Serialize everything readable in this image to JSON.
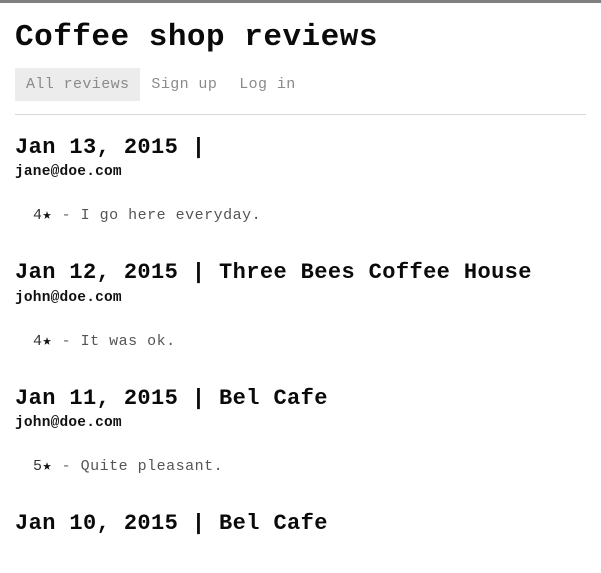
{
  "site": {
    "title": "Coffee shop reviews"
  },
  "nav": {
    "items": [
      {
        "label": "All reviews",
        "active": true
      },
      {
        "label": "Sign up",
        "active": false
      },
      {
        "label": "Log in",
        "active": false
      }
    ]
  },
  "reviews": [
    {
      "date": "Jan 13, 2015",
      "separator": "|",
      "shop": "",
      "heading": "Jan 13, 2015 |",
      "email": "jane@doe.com",
      "rating": "4",
      "star": "★",
      "dash": "-",
      "text": "I go here everyday."
    },
    {
      "date": "Jan 12, 2015",
      "separator": "|",
      "shop": "Three Bees Coffee House",
      "heading": "Jan 12, 2015 | Three Bees Coffee House",
      "email": "john@doe.com",
      "rating": "4",
      "star": "★",
      "dash": "-",
      "text": "It was ok."
    },
    {
      "date": "Jan 11, 2015",
      "separator": "|",
      "shop": "Bel Cafe",
      "heading": "Jan 11, 2015 | Bel Cafe",
      "email": "john@doe.com",
      "rating": "5",
      "star": "★",
      "dash": "-",
      "text": "Quite pleasant."
    },
    {
      "date": "Jan 10, 2015",
      "separator": "|",
      "shop": "Bel Cafe",
      "heading": "Jan 10, 2015 | Bel Cafe",
      "email": "",
      "rating": "",
      "star": "",
      "dash": "",
      "text": ""
    }
  ],
  "colors": {
    "background": "#ffffff",
    "heading_text": "#0a0a0a",
    "nav_inactive": "#8a8a8a",
    "nav_active_bg": "#ececec",
    "rule": "#d7d7d7",
    "review_text": "#555555",
    "top_strip": "#808080"
  }
}
